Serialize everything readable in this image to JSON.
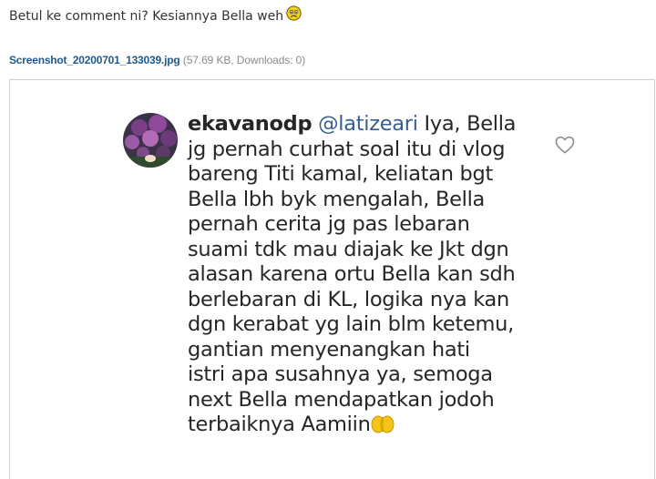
{
  "post": {
    "text": "Betul ke comment ni? Kesiannya Bella weh",
    "emoji": "worried-face-icon"
  },
  "attachment": {
    "filename": "Screenshot_20200701_133039.jpg",
    "meta": "(57.69 KB, Downloads: 0)"
  },
  "comment": {
    "username": "ekavanodp",
    "mention": "@latizeari",
    "first_line_rest": " Iya, Bella",
    "lines": [
      "jg pernah curhat soal itu di vlog",
      "bareng Titi kamal, keliatan bgt",
      "Bella lbh byk mengalah, Bella",
      "pernah cerita jg pas lebaran",
      "suami tdk mau diajak ke Jkt dgn",
      "alasan karena ortu Bella kan sdh",
      "berlebaran di KL, logika nya kan",
      "dgn kerabat yg lain blm ketemu,",
      "gantian menyenangkan hati",
      "istri apa susahnya ya, semoga",
      "next Bella mendapatkan jodoh"
    ],
    "last_line": "terbaiknya Aamiin",
    "end_emoji": "folded-hands-icon"
  },
  "colors": {
    "text": "#333333",
    "link": "#1f5a8f",
    "meta": "#8a8a8a",
    "mention": "#385d8f",
    "comment_text": "#262626"
  }
}
